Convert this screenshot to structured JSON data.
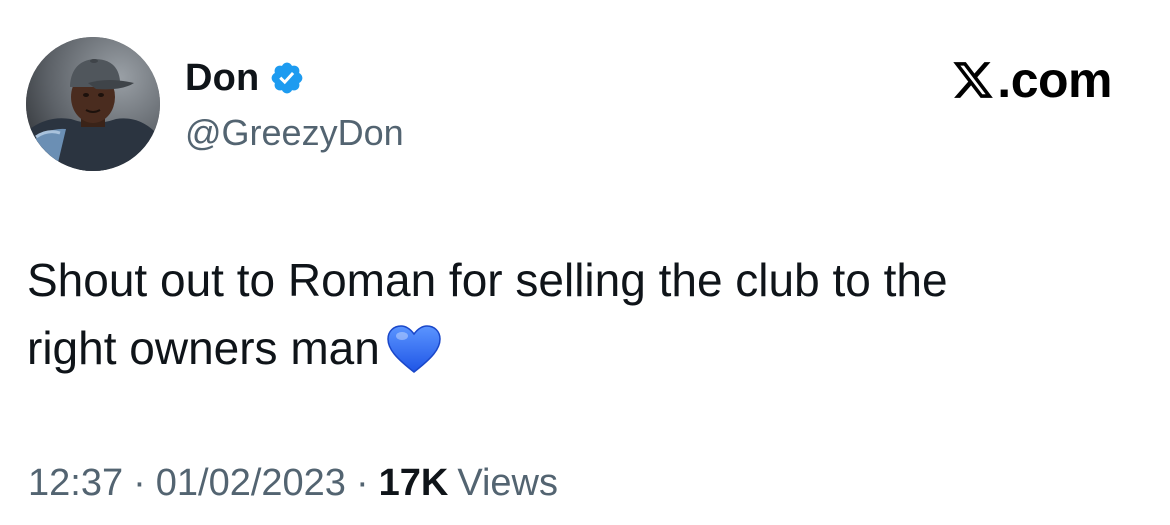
{
  "author": {
    "display_name": "Don",
    "handle": "@GreezyDon",
    "verified": true,
    "badge_color": "#1d9bf0",
    "avatar_icon": "profile-photo"
  },
  "brand": {
    "text": ".com",
    "icon": "x-logo-icon"
  },
  "tweet": {
    "line1": "Shout out to Roman for selling the club to the",
    "line2": "right owners man",
    "emoji": "blue-heart-icon",
    "emoji_color": "#2f6cf2"
  },
  "meta": {
    "time": "12:37",
    "separator": "·",
    "date": "01/02/2023",
    "views_count": "17K",
    "views_label": "Views"
  },
  "colors": {
    "text_primary": "#0f1419",
    "text_secondary": "#536471",
    "background": "#ffffff"
  }
}
